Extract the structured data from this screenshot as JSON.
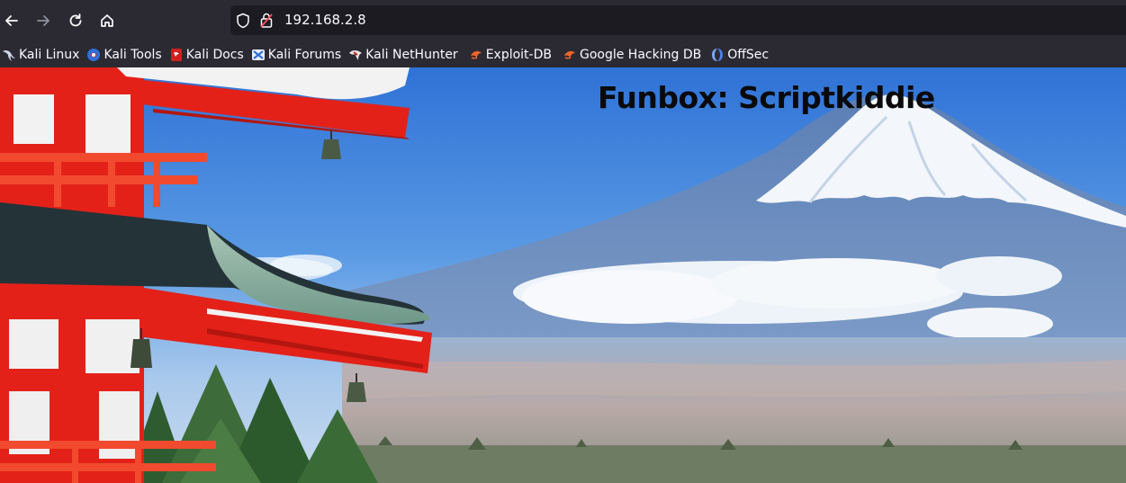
{
  "browser": {
    "url": "192.168.2.8",
    "nav": {
      "back": "back-arrow-icon",
      "forward": "forward-arrow-icon",
      "reload": "reload-icon",
      "home": "home-icon"
    },
    "bookmarks": [
      {
        "label": "Kali Linux",
        "icon": "kali-dragon-icon"
      },
      {
        "label": "Kali Tools",
        "icon": "kali-tools-icon"
      },
      {
        "label": "Kali Docs",
        "icon": "kali-docs-icon"
      },
      {
        "label": "Kali Forums",
        "icon": "kali-forums-icon"
      },
      {
        "label": "Kali NetHunter",
        "icon": "kali-nethunter-icon"
      },
      {
        "label": "Exploit-DB",
        "icon": "exploit-db-icon"
      },
      {
        "label": "Google Hacking DB",
        "icon": "ghdb-icon"
      },
      {
        "label": "OffSec",
        "icon": "offsec-icon"
      }
    ]
  },
  "page": {
    "title": "Funbox: Scriptkiddie",
    "background": "mount-fuji-pagoda-photo"
  },
  "colors": {
    "chrome": "#2b2a33",
    "urlbar": "#1c1b22",
    "pagoda_red": "#e8241a",
    "sky": "#4f93e0"
  }
}
